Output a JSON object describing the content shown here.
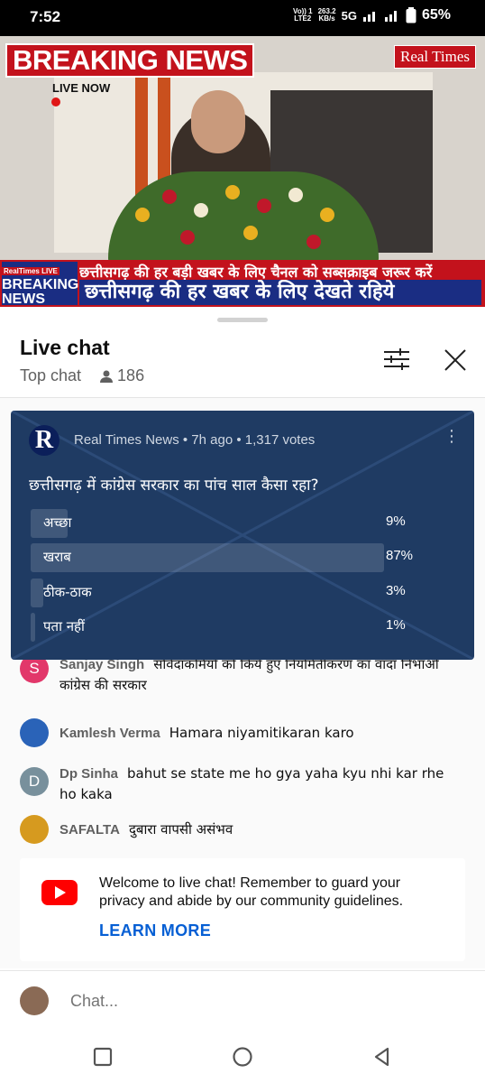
{
  "status_bar": {
    "time": "7:52",
    "volte_top": "Vo)) 1",
    "volte_bottom": "LTE2",
    "speed_value": "263.2",
    "speed_unit": "KB/s",
    "network": "5G",
    "battery": "65%"
  },
  "video": {
    "breaking_news": "BREAKING NEWS",
    "live_now": "LIVE NOW",
    "brand": "Real Times",
    "ticker_top": "छत्तीसगढ़ की हर बड़ी खबर के लिए चैनल को सब्सक्राइब जरूर करें",
    "ticker_bottom": "छत्तीसगढ़ की हर खबर के लिए देखते रहिये",
    "tag_mini": "RealTimes LIVE",
    "tag_line1": "BREAKING",
    "tag_line2": "NEWS"
  },
  "live_chat": {
    "title": "Live chat",
    "mode": "Top chat",
    "viewers": "186"
  },
  "poll": {
    "avatar_letter": "R",
    "meta": "Real Times News • 7h ago • 1,317 votes",
    "question": "छत्तीसगढ़ में कांग्रेस सरकार का पांच साल कैसा रहा?",
    "options": [
      {
        "label": "अच्छा",
        "percent_text": "9%",
        "share": 0.09
      },
      {
        "label": "खराब",
        "percent_text": "87%",
        "share": 0.87
      },
      {
        "label": "ठीक-ठाक",
        "percent_text": "3%",
        "share": 0.03
      },
      {
        "label": "पता नहीं",
        "percent_text": "1%",
        "share": 0.01
      }
    ]
  },
  "messages": [
    {
      "author": "Sanjay Singh",
      "text": "संविदाकर्मियों को किये हुए नियमितीकरण का वादा निभाओ कांग्रेस की सरकार",
      "avatar_letter": "S"
    },
    {
      "author": "Kamlesh Verma",
      "text": "Hamara niyamitikaran karo",
      "avatar_letter": ""
    },
    {
      "author": "Dp Sinha",
      "text": "bahut se state me ho gya yaha kyu nhi kar rhe ho kaka",
      "avatar_letter": "D"
    },
    {
      "author": "SAFALTA",
      "text": "दुबारा वापसी असंभव",
      "avatar_letter": ""
    }
  ],
  "welcome": {
    "text": "Welcome to live chat! Remember to guard your privacy and abide by our community guidelines.",
    "learn_more": "LEARN MORE"
  },
  "input": {
    "placeholder": "Chat..."
  },
  "colors": {
    "youtube_red": "#ff0000",
    "link_blue": "#065fd4",
    "poll_bg": "#1f3b63",
    "news_red": "#c3121c",
    "news_blue": "#1a2d83"
  }
}
